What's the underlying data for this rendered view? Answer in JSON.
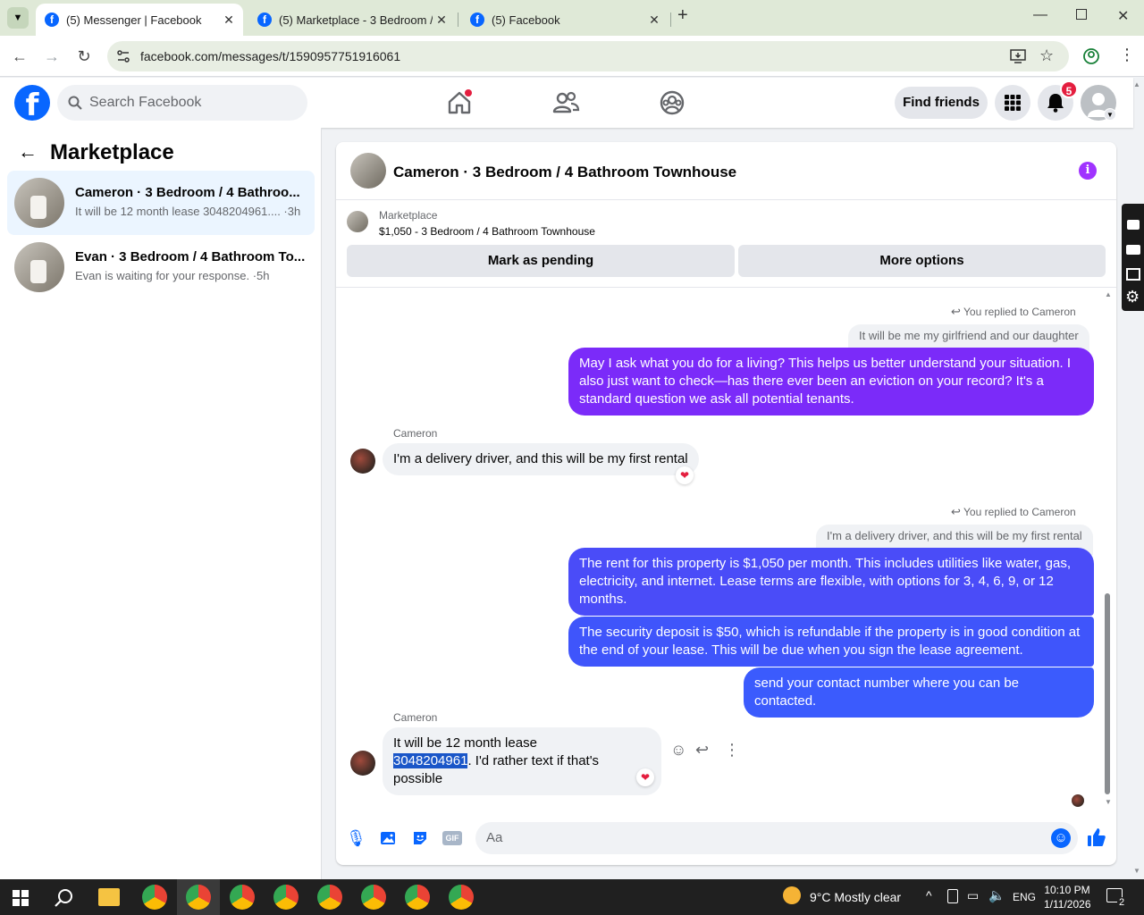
{
  "browser": {
    "tabs": [
      {
        "title": "(5) Messenger | Facebook",
        "active": true
      },
      {
        "title": "(5) Marketplace - 3 Bedroom / 4",
        "active": false
      },
      {
        "title": "(5) Facebook",
        "active": false
      }
    ],
    "new_tab": "+",
    "url": "facebook.com/messages/t/1590957751916061"
  },
  "fb_nav": {
    "logo": "f",
    "search_placeholder": "Search Facebook",
    "find_friends": "Find friends",
    "notifications_count": "5"
  },
  "sidebar": {
    "title": "Marketplace",
    "conversations": [
      {
        "name": "Cameron · 3 Bedroom / 4 Bathroo...",
        "preview": "It will be 12 month lease 3048204961.... ·3h",
        "active": true
      },
      {
        "name": "Evan · 3 Bedroom / 4 Bathroom To...",
        "preview": "Evan is waiting for your response. ·5h",
        "active": false
      }
    ]
  },
  "chat": {
    "title": "Cameron · 3 Bedroom / 4 Bathroom Townhouse",
    "marketplace_label": "Marketplace",
    "listing": "$1,050 - 3 Bedroom / 4 Bathroom Townhouse",
    "mark_pending": "Mark as pending",
    "more_options": "More options",
    "replied_1": "You replied to Cameron",
    "quote_1": "It will be me my girlfriend and our daughter",
    "out_1": "May I ask what you do for a living? This helps us better understand your situation. I also just want to check—has there ever been an eviction on your record? It's a standard question we ask all potential tenants.",
    "sender_1": "Cameron",
    "in_1": "I'm a delivery driver, and this will be my first rental",
    "replied_2": "You replied to Cameron",
    "quote_2": "I'm a delivery driver, and this will be my first rental",
    "out_2": "The rent for this property is $1,050 per month. This includes utilities like water, gas, electricity, and internet. Lease terms are flexible, with options for 3, 4, 6, 9, or 12 months.",
    "out_3": "The security deposit is $50, which is refundable if the property is in good condition at the end of your lease. This will be due when you sign the lease agreement.",
    "out_4": "send your contact number where you can be contacted.",
    "sender_2": "Cameron",
    "in_2_line1": "It will be 12 month lease",
    "in_2_phone": "3048204961",
    "in_2_rest": ". I'd rather text if that's possible",
    "composer_placeholder": "Aa",
    "colors": {
      "out_purple": "#7b2bf9",
      "out_blue": "#3b5bfd",
      "accent": "#0866ff"
    }
  },
  "taskbar": {
    "weather": "9°C  Mostly clear",
    "lang": "ENG",
    "time": "10:10 PM",
    "date": "1/11/2026",
    "notif": "2"
  }
}
